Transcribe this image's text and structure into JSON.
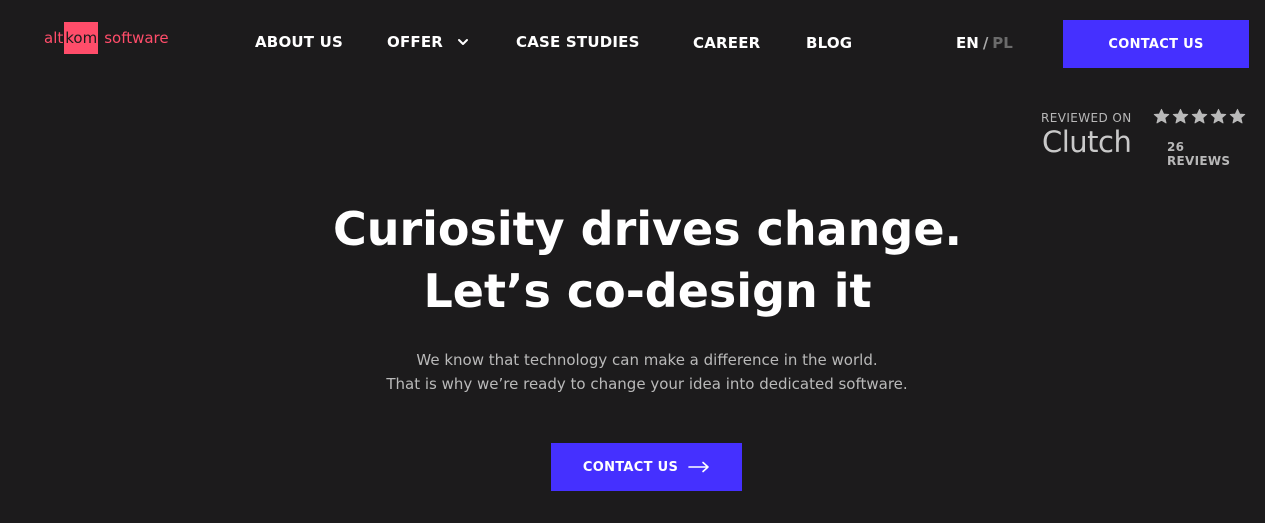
{
  "logo": {
    "left": "alt",
    "box": "kom",
    "right": "software"
  },
  "nav": {
    "items": [
      {
        "label": "ABOUT US"
      },
      {
        "label": "OFFER"
      },
      {
        "label": "CASE STUDIES"
      },
      {
        "label": "CAREER"
      },
      {
        "label": "BLOG"
      }
    ],
    "offer_icon": "chevron-down-icon"
  },
  "language": {
    "active": "EN",
    "separator": "/",
    "inactive": "PL"
  },
  "header_cta": {
    "label": "CONTACT US"
  },
  "clutch": {
    "reviewed_label": "REVIEWED ON",
    "brand": "Clutch",
    "rating_stars": 5,
    "reviews_label": "26 REVIEWS",
    "star_icon": "star-icon"
  },
  "hero": {
    "title_line1": "Curiosity drives change.",
    "title_line2": "Let’s co-design it",
    "subtitle_line1": "We know that technology can make a difference in the world.",
    "subtitle_line2": "That is why we’re ready to change your idea into dedicated software.",
    "cta_label": "CONTACT US",
    "cta_icon": "arrow-right-icon"
  },
  "colors": {
    "background": "#1c1b1c",
    "accent": "#4530ff",
    "brand_pink": "#ff4d6a"
  }
}
